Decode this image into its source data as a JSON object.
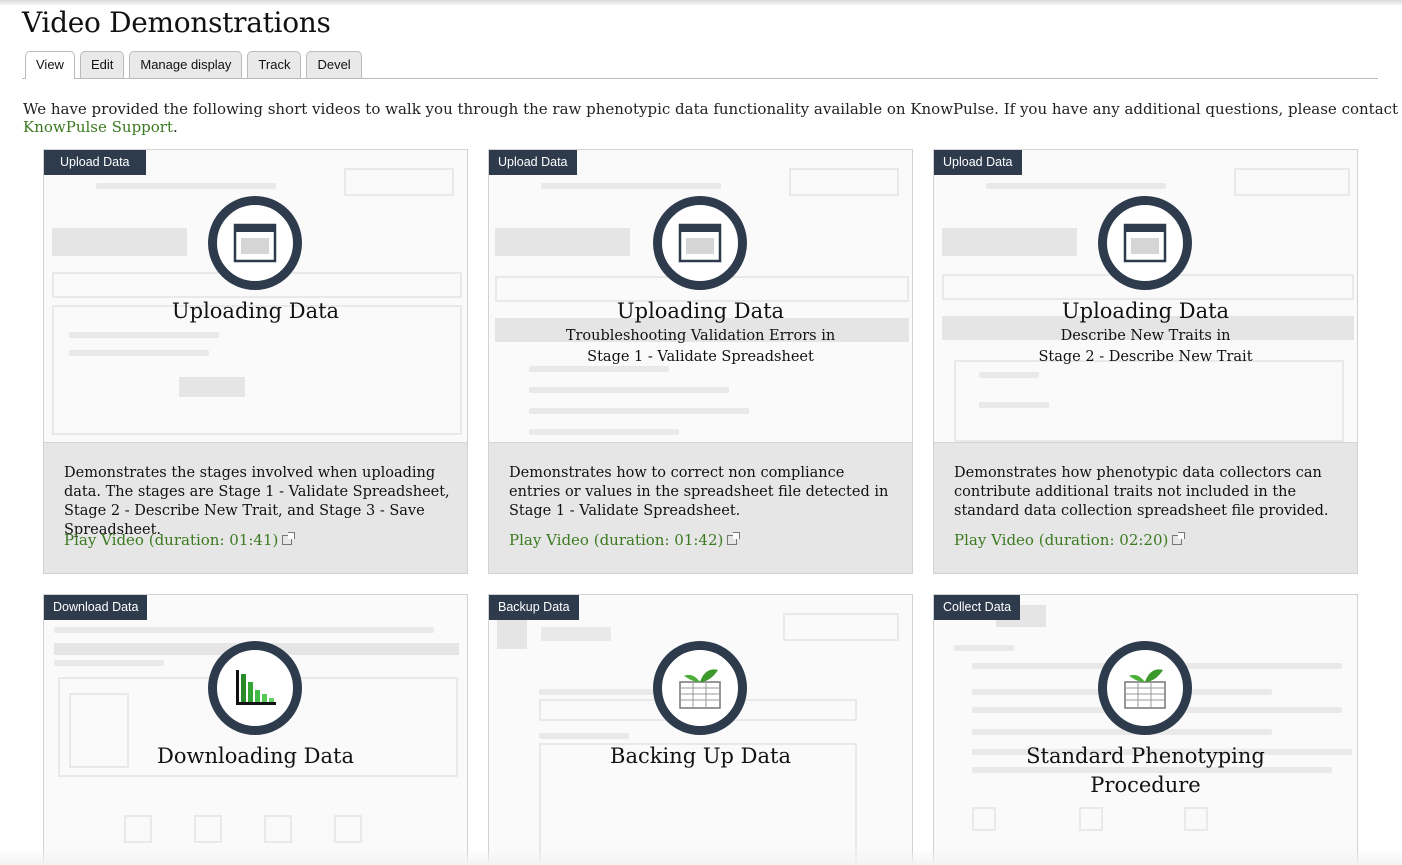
{
  "page": {
    "title": "Video Demonstrations",
    "intro_text": "We have provided the following short videos to walk you through the raw phenotypic data functionality available on KnowPulse. If you have any additional questions, please contact ",
    "intro_link": "KnowPulse Support",
    "intro_end": "."
  },
  "tabs": [
    {
      "label": "View",
      "active": true
    },
    {
      "label": "Edit"
    },
    {
      "label": "Manage display"
    },
    {
      "label": "Track"
    },
    {
      "label": "Devel"
    }
  ],
  "colors": {
    "badge": "#2d3b4d",
    "link": "#3b7a20",
    "desc_bg": "#e6e6e6"
  },
  "cards": [
    {
      "badge": "Upload Data",
      "icon": "window-icon",
      "title": "Uploading Data",
      "subtitle_1": "",
      "subtitle_2": "",
      "description": "Demonstrates the stages involved when uploading data. The stages are Stage 1 - Validate Spreadsheet, Stage 2 - Describe New Trait, and Stage 3 - Save Spreadsheet.",
      "play_label": "Play Video (duration: 01:41)"
    },
    {
      "badge": "Upload Data",
      "icon": "window-icon",
      "title": "Uploading Data",
      "subtitle_1": "Troubleshooting Validation Errors in",
      "subtitle_2": "Stage 1 - Validate Spreadsheet",
      "description": "Demonstrates how to correct non compliance entries or values in the spreadsheet file detected in Stage 1 - Validate Spreadsheet.",
      "play_label": "Play Video (duration: 01:42)"
    },
    {
      "badge": "Upload Data",
      "icon": "window-icon",
      "title": "Uploading Data",
      "subtitle_1": "Describe New Traits in",
      "subtitle_2": "Stage 2 - Describe New Trait",
      "description": "Demonstrates how phenotypic data collectors can contribute additional traits not included in the standard data collection spreadsheet file provided.",
      "play_label": "Play Video (duration: 02:20)"
    },
    {
      "badge": "Download Data",
      "icon": "bar-chart-icon",
      "title": "Downloading Data"
    },
    {
      "badge": "Backup Data",
      "icon": "spreadsheet-leaf-icon",
      "title": "Backing Up Data"
    },
    {
      "badge": "Collect Data",
      "icon": "spreadsheet-leaf-icon",
      "title": "Standard Phenotyping",
      "title_2": "Procedure"
    }
  ]
}
